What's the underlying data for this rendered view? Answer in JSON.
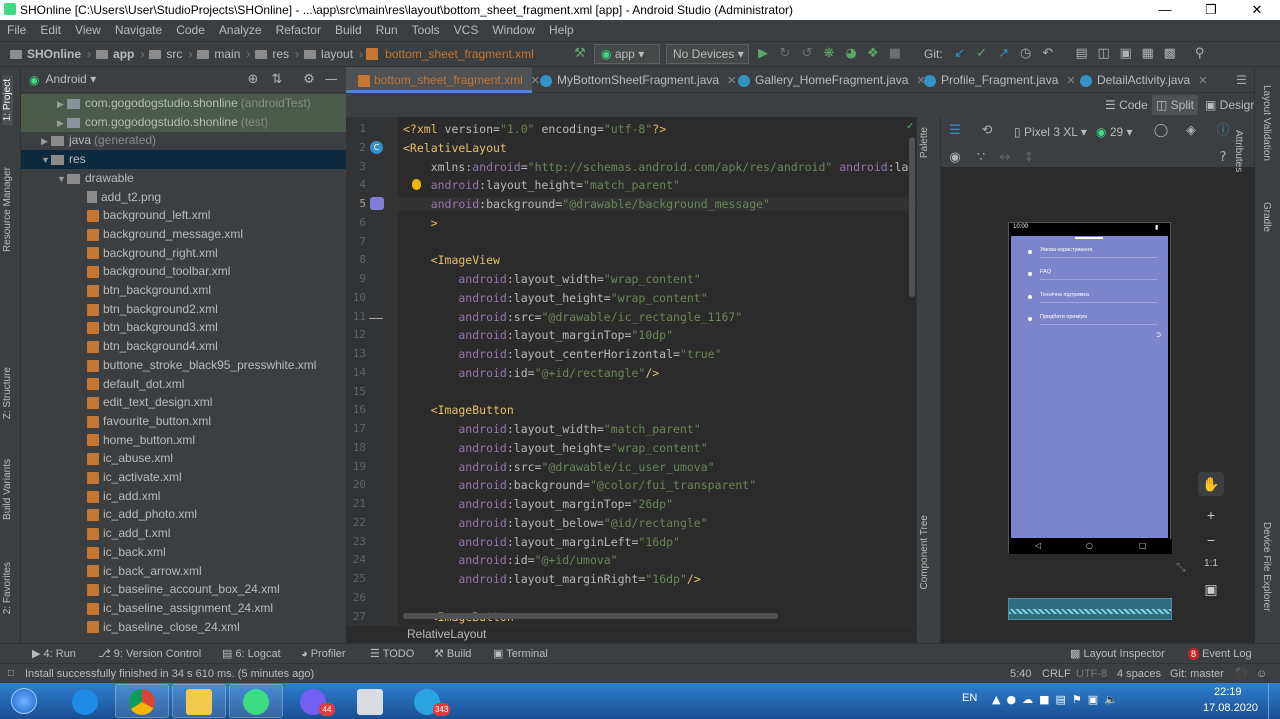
{
  "window": {
    "title": "SHOnline [C:\\Users\\User\\StudioProjects\\SHOnline] - ...\\app\\src\\main\\res\\layout\\bottom_sheet_fragment.xml [app] - Android Studio (Administrator)"
  },
  "menu": [
    "File",
    "Edit",
    "View",
    "Navigate",
    "Code",
    "Analyze",
    "Refactor",
    "Build",
    "Run",
    "Tools",
    "VCS",
    "Window",
    "Help"
  ],
  "breadcrumb": [
    "SHOnline",
    "app",
    "src",
    "main",
    "res",
    "layout",
    "bottom_sheet_fragment.xml"
  ],
  "toolbar": {
    "run_config": "app",
    "device": "No Devices",
    "git_label": "Git:"
  },
  "project_panel": {
    "view_label": "Android",
    "items": [
      {
        "label": "com.gogodogstudio.shonline",
        "suffix": "(androidTest)",
        "type": "pkg",
        "indent": 1,
        "expanded": false
      },
      {
        "label": "com.gogodogstudio.shonline",
        "suffix": "(test)",
        "type": "pkg",
        "indent": 1,
        "expanded": false
      },
      {
        "label": "java",
        "suffix": "(generated)",
        "type": "folder",
        "indent": 0,
        "expanded": false
      },
      {
        "label": "res",
        "suffix": "",
        "type": "folder",
        "indent": 0,
        "expanded": true,
        "selected": true
      },
      {
        "label": "drawable",
        "suffix": "",
        "type": "folder",
        "indent": 1,
        "expanded": true
      },
      {
        "label": "add_t2.png",
        "type": "file",
        "indent": 2
      },
      {
        "label": "background_left.xml",
        "type": "xml",
        "indent": 2
      },
      {
        "label": "background_message.xml",
        "type": "xml",
        "indent": 2
      },
      {
        "label": "background_right.xml",
        "type": "xml",
        "indent": 2
      },
      {
        "label": "background_toolbar.xml",
        "type": "xml",
        "indent": 2
      },
      {
        "label": "btn_background.xml",
        "type": "xml",
        "indent": 2
      },
      {
        "label": "btn_background2.xml",
        "type": "xml",
        "indent": 2
      },
      {
        "label": "btn_background3.xml",
        "type": "xml",
        "indent": 2
      },
      {
        "label": "btn_background4.xml",
        "type": "xml",
        "indent": 2
      },
      {
        "label": "buttone_stroke_black95_presswhite.xml",
        "type": "xml",
        "indent": 2
      },
      {
        "label": "default_dot.xml",
        "type": "xml",
        "indent": 2
      },
      {
        "label": "edit_text_design.xml",
        "type": "xml",
        "indent": 2
      },
      {
        "label": "favourite_button.xml",
        "type": "xml",
        "indent": 2
      },
      {
        "label": "home_button.xml",
        "type": "xml",
        "indent": 2
      },
      {
        "label": "ic_abuse.xml",
        "type": "xml",
        "indent": 2
      },
      {
        "label": "ic_activate.xml",
        "type": "xml",
        "indent": 2
      },
      {
        "label": "ic_add.xml",
        "type": "xml",
        "indent": 2
      },
      {
        "label": "ic_add_photo.xml",
        "type": "xml",
        "indent": 2
      },
      {
        "label": "ic_add_t.xml",
        "type": "xml",
        "indent": 2
      },
      {
        "label": "ic_back.xml",
        "type": "xml",
        "indent": 2
      },
      {
        "label": "ic_back_arrow.xml",
        "type": "xml",
        "indent": 2
      },
      {
        "label": "ic_baseline_account_box_24.xml",
        "type": "xml",
        "indent": 2
      },
      {
        "label": "ic_baseline_assignment_24.xml",
        "type": "xml",
        "indent": 2
      },
      {
        "label": "ic_baseline_close_24.xml",
        "type": "xml",
        "indent": 2
      }
    ]
  },
  "editor_tabs": [
    {
      "label": "bottom_sheet_fragment.xml",
      "icon": "xml",
      "active": true
    },
    {
      "label": "MyBottomSheetFragment.java",
      "icon": "class"
    },
    {
      "label": "Gallery_HomeFragment.java",
      "icon": "class"
    },
    {
      "label": "Profile_Fragment.java",
      "icon": "class"
    },
    {
      "label": "DetailActivity.java",
      "icon": "class"
    }
  ],
  "view_modes": {
    "code": "Code",
    "split": "Split",
    "design": "Design"
  },
  "code_lines": [
    {
      "n": "1",
      "parts": [
        [
          "tg",
          "<?xml "
        ],
        [
          "at",
          "version="
        ],
        [
          "val",
          "\"1.0\" "
        ],
        [
          "at",
          "encoding="
        ],
        [
          "val",
          "\"utf-8\""
        ],
        [
          "tg",
          "?>"
        ]
      ]
    },
    {
      "n": "2",
      "parts": [
        [
          "tg",
          "<RelativeLayout"
        ]
      ]
    },
    {
      "n": "3",
      "parts": [
        [
          "at",
          "    xmlns:"
        ],
        [
          "ns",
          "android"
        ],
        [
          "at",
          "="
        ],
        [
          "val",
          "\"http://schemas.android.com/apk/res/android\" "
        ],
        [
          "ns",
          "android"
        ],
        [
          "at",
          ":layout_w"
        ]
      ]
    },
    {
      "n": "4",
      "parts": [
        [
          "ns",
          "    android"
        ],
        [
          "at",
          ":layout_height="
        ],
        [
          "val",
          "\"match_parent\""
        ]
      ]
    },
    {
      "n": "5",
      "parts": [
        [
          "ns",
          "    android"
        ],
        [
          "at",
          ":background="
        ],
        [
          "val",
          "\"@drawable/background_message\""
        ]
      ]
    },
    {
      "n": "6",
      "parts": [
        [
          "tg",
          "    >"
        ]
      ]
    },
    {
      "n": "7",
      "parts": []
    },
    {
      "n": "8",
      "parts": [
        [
          "tg",
          "    <ImageView"
        ]
      ]
    },
    {
      "n": "9",
      "parts": [
        [
          "ns",
          "        android"
        ],
        [
          "at",
          ":layout_width="
        ],
        [
          "val",
          "\"wrap_content\""
        ]
      ]
    },
    {
      "n": "10",
      "parts": [
        [
          "ns",
          "        android"
        ],
        [
          "at",
          ":layout_height="
        ],
        [
          "val",
          "\"wrap_content\""
        ]
      ]
    },
    {
      "n": "11",
      "parts": [
        [
          "ns",
          "        android"
        ],
        [
          "at",
          ":src="
        ],
        [
          "val",
          "\"@drawable/ic_rectangle_1167\""
        ]
      ]
    },
    {
      "n": "12",
      "parts": [
        [
          "ns",
          "        android"
        ],
        [
          "at",
          ":layout_marginTop="
        ],
        [
          "val",
          "\"10dp\""
        ]
      ]
    },
    {
      "n": "13",
      "parts": [
        [
          "ns",
          "        android"
        ],
        [
          "at",
          ":layout_centerHorizontal="
        ],
        [
          "val",
          "\"true\""
        ]
      ]
    },
    {
      "n": "14",
      "parts": [
        [
          "ns",
          "        android"
        ],
        [
          "at",
          ":id="
        ],
        [
          "val",
          "\"@+id/rectangle\""
        ],
        [
          "tg",
          "/>"
        ]
      ]
    },
    {
      "n": "15",
      "parts": []
    },
    {
      "n": "16",
      "parts": [
        [
          "tg",
          "    <ImageButton"
        ]
      ]
    },
    {
      "n": "17",
      "parts": [
        [
          "ns",
          "        android"
        ],
        [
          "at",
          ":layout_width="
        ],
        [
          "val",
          "\"match_parent\""
        ]
      ]
    },
    {
      "n": "18",
      "parts": [
        [
          "ns",
          "        android"
        ],
        [
          "at",
          ":layout_height="
        ],
        [
          "val",
          "\"wrap_content\""
        ]
      ]
    },
    {
      "n": "19",
      "parts": [
        [
          "ns",
          "        android"
        ],
        [
          "at",
          ":src="
        ],
        [
          "val",
          "\"@drawable/ic_user_umova\""
        ]
      ]
    },
    {
      "n": "20",
      "parts": [
        [
          "ns",
          "        android"
        ],
        [
          "at",
          ":background="
        ],
        [
          "val",
          "\"@color/fui_transparent\""
        ]
      ]
    },
    {
      "n": "21",
      "parts": [
        [
          "ns",
          "        android"
        ],
        [
          "at",
          ":layout_marginTop="
        ],
        [
          "val",
          "\"26dp\""
        ]
      ]
    },
    {
      "n": "22",
      "parts": [
        [
          "ns",
          "        android"
        ],
        [
          "at",
          ":layout_below="
        ],
        [
          "val",
          "\"@id/rectangle\""
        ]
      ]
    },
    {
      "n": "23",
      "parts": [
        [
          "ns",
          "        android"
        ],
        [
          "at",
          ":layout_marginLeft="
        ],
        [
          "val",
          "\"16dp\""
        ]
      ]
    },
    {
      "n": "24",
      "parts": [
        [
          "ns",
          "        android"
        ],
        [
          "at",
          ":id="
        ],
        [
          "val",
          "\"@+id/umova\""
        ]
      ]
    },
    {
      "n": "25",
      "parts": [
        [
          "ns",
          "        android"
        ],
        [
          "at",
          ":layout_marginRight="
        ],
        [
          "val",
          "\"16dp\""
        ],
        [
          "tg",
          "/>"
        ]
      ]
    },
    {
      "n": "26",
      "parts": []
    },
    {
      "n": "27",
      "parts": [
        [
          "tg",
          "    <ImageButton"
        ]
      ]
    }
  ],
  "editor_breadcrumb": "RelativeLayout",
  "design_toolbar": {
    "device": "Pixel 3 XL",
    "api": "29"
  },
  "left_tool_tabs": [
    "1: Project",
    "Resource Manager",
    "Z: Structure",
    "Build Variants",
    "2: Favorites"
  ],
  "right_tool_tabs": [
    "Layout Validation",
    "Gradle",
    "Device File Explorer"
  ],
  "palette_tabs": [
    "Palette",
    "Attributes",
    "Component Tree"
  ],
  "phone_preview": {
    "time": "10:00",
    "items": [
      "Умова користування",
      "FAQ",
      "Технічна підтримка",
      "Придбати преміум"
    ]
  },
  "zoom_controls": {
    "fit_label": "1:1"
  },
  "bottom_tools": [
    {
      "label": "4: Run"
    },
    {
      "label": "9: Version Control"
    },
    {
      "label": "6: Logcat"
    },
    {
      "label": "Profiler"
    },
    {
      "label": "TODO"
    },
    {
      "label": "Build"
    },
    {
      "label": "Terminal"
    }
  ],
  "bottom_right_tools": {
    "layout_inspector": "Layout Inspector",
    "event_log": "Event Log",
    "event_count": "8"
  },
  "status": {
    "message": "Install successfully finished in 34 s 610 ms. (5 minutes ago)",
    "position": "5:40",
    "line_sep": "CRLF",
    "encoding": "UTF-8",
    "indent": "4 spaces",
    "git": "Git: master"
  },
  "taskbar": {
    "lang": "EN",
    "time": "22:19",
    "date": "17.08.2020",
    "viber_badge": "44",
    "telegram_badge": "343"
  },
  "colors": {
    "accent": "#3592c4",
    "xml_icon": "#c57633",
    "phone_bg": "#7b85cc"
  }
}
